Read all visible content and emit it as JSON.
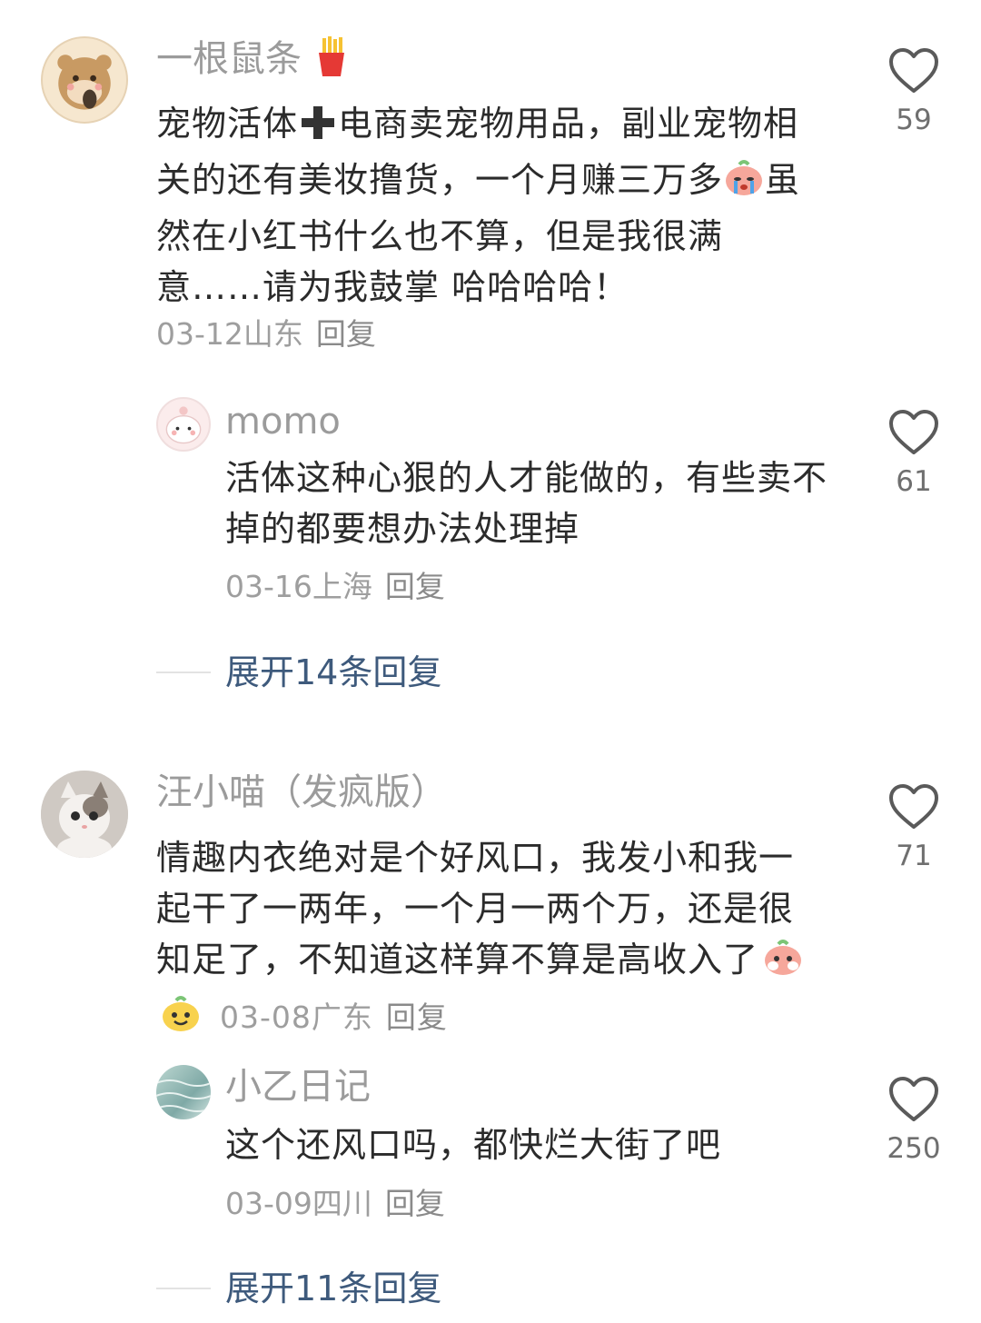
{
  "comments": [
    {
      "user": "一根鼠条",
      "text_part1": "宠物活体",
      "text_part2": "电商卖宠物用品，副业宠物相关的还有美妆撸货，一个月赚三万多",
      "text_part3": "虽然在小红书什么也不算，但是我很满意……请为我鼓掌 哈哈哈哈！",
      "date": "03-12",
      "location": "山东",
      "reply": "回复",
      "likes": "59",
      "replies": [
        {
          "user": "momo",
          "text": "活体这种心狠的人才能做的，有些卖不掉的都要想办法处理掉",
          "date": "03-16",
          "location": "上海",
          "reply": "回复",
          "likes": "61"
        }
      ],
      "expand": "展开14条回复"
    },
    {
      "user": "汪小喵（发疯版）",
      "text": "情趣内衣绝对是个好风口，我发小和我一起干了一两年，一个月一两个万，还是很知足了，不知道这样算不算是高收入了",
      "date": "03-08",
      "location": "广东",
      "reply": "回复",
      "likes": "71",
      "replies": [
        {
          "user": "小乙日记",
          "text": "这个还风口吗，都快烂大街了吧",
          "date": "03-09",
          "location": "四川",
          "reply": "回复",
          "likes": "250"
        }
      ],
      "expand": "展开11条回复"
    }
  ]
}
